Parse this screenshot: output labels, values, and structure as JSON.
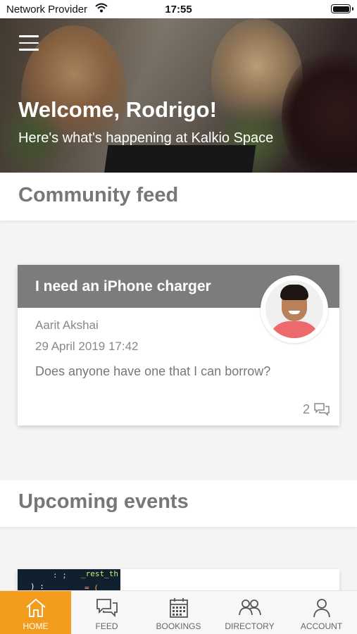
{
  "status_bar": {
    "carrier": "Network Provider",
    "time": "17:55"
  },
  "hero": {
    "title": "Welcome, Rodrigo!",
    "subtitle": "Here's what's happening at Kalkio Space"
  },
  "sections": {
    "community_feed": "Community feed",
    "upcoming_events": "Upcoming events"
  },
  "post": {
    "title": "I need an iPhone charger",
    "author": "Aarit Akshai",
    "date": "29 April 2019 17:42",
    "body": "Does anyone have one that I can borrow?",
    "comment_count": "2"
  },
  "event_thumb_code": [
    ": ;",
    "_rest_th",
    ") :",
    "= ("
  ],
  "tabs": [
    {
      "label": "HOME",
      "icon": "home-icon",
      "active": true
    },
    {
      "label": "FEED",
      "icon": "chat-icon",
      "active": false
    },
    {
      "label": "BOOKINGS",
      "icon": "calendar-icon",
      "active": false
    },
    {
      "label": "DIRECTORY",
      "icon": "people-icon",
      "active": false
    },
    {
      "label": "ACCOUNT",
      "icon": "person-icon",
      "active": false
    }
  ],
  "colors": {
    "accent": "#f39b1d",
    "post_header": "#7c7c7c",
    "text_gray": "#777777"
  }
}
